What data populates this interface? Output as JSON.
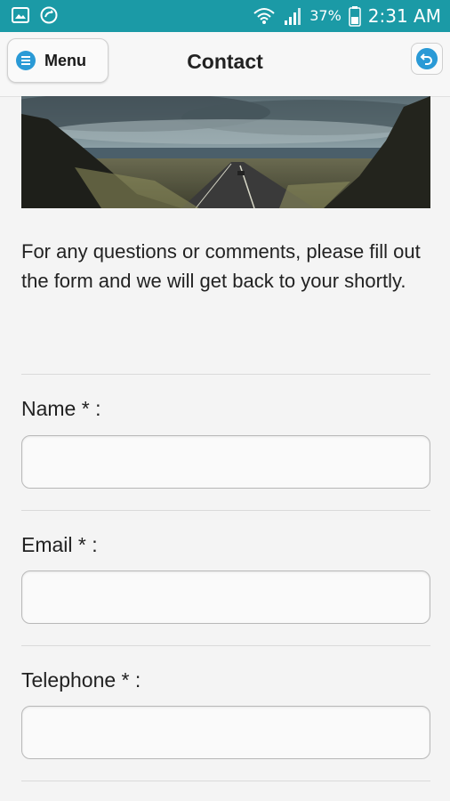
{
  "status_bar": {
    "battery_percent": "37%",
    "time": "2:31 AM",
    "icons": [
      "gallery-icon",
      "sync-icon",
      "wifi-icon",
      "signal-icon",
      "battery-icon"
    ]
  },
  "header": {
    "menu_label": "Menu",
    "title": "Contact"
  },
  "intro_text": "For any questions or comments, please fill out the form and we will get back to your shortly.",
  "form": {
    "name_label": "Name * :",
    "email_label": "Email * :",
    "telephone_label": "Telephone * :",
    "name_value": "",
    "email_value": "",
    "telephone_value": ""
  },
  "colors": {
    "status_bar": "#1b9aa6",
    "accent": "#2a9ad6"
  }
}
